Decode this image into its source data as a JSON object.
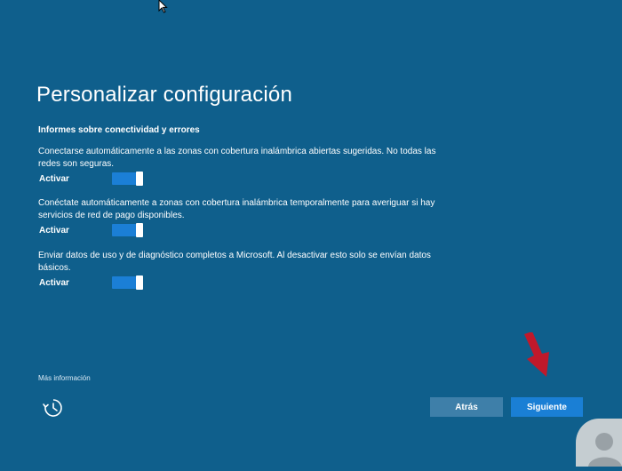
{
  "page": {
    "title": "Personalizar configuración",
    "section_heading": "Informes sobre conectividad y errores"
  },
  "settings": [
    {
      "description": "Conectarse automáticamente a las zonas con cobertura inalámbrica abiertas sugeridas. No todas las redes son seguras.",
      "toggle_label": "Activar",
      "enabled": true
    },
    {
      "description": "Conéctate automáticamente a zonas con cobertura inalámbrica temporalmente para averiguar si hay servicios de red de pago disponibles.",
      "toggle_label": "Activar",
      "enabled": true
    },
    {
      "description": "Enviar datos de uso y de diagnóstico completos a Microsoft. Al desactivar esto solo se envían datos básicos.",
      "toggle_label": "Activar",
      "enabled": true
    }
  ],
  "footer": {
    "more_info_link": "Más información",
    "accessibility_icon": "ease-of-access-icon",
    "back_label": "Atrás",
    "next_label": "Siguiente"
  },
  "overlay": {
    "pointer_icon": "mouse-cursor-icon",
    "annotation_arrow_icon": "red-arrow-icon",
    "watermark_icon": "avatar-watermark-icon"
  },
  "colors": {
    "background": "#0f5f8c",
    "toggle_on": "#1b7fd6",
    "primary_button": "#1a7fd5",
    "secondary_button": "#3e7fa9",
    "annotation_arrow": "#c0192b"
  }
}
